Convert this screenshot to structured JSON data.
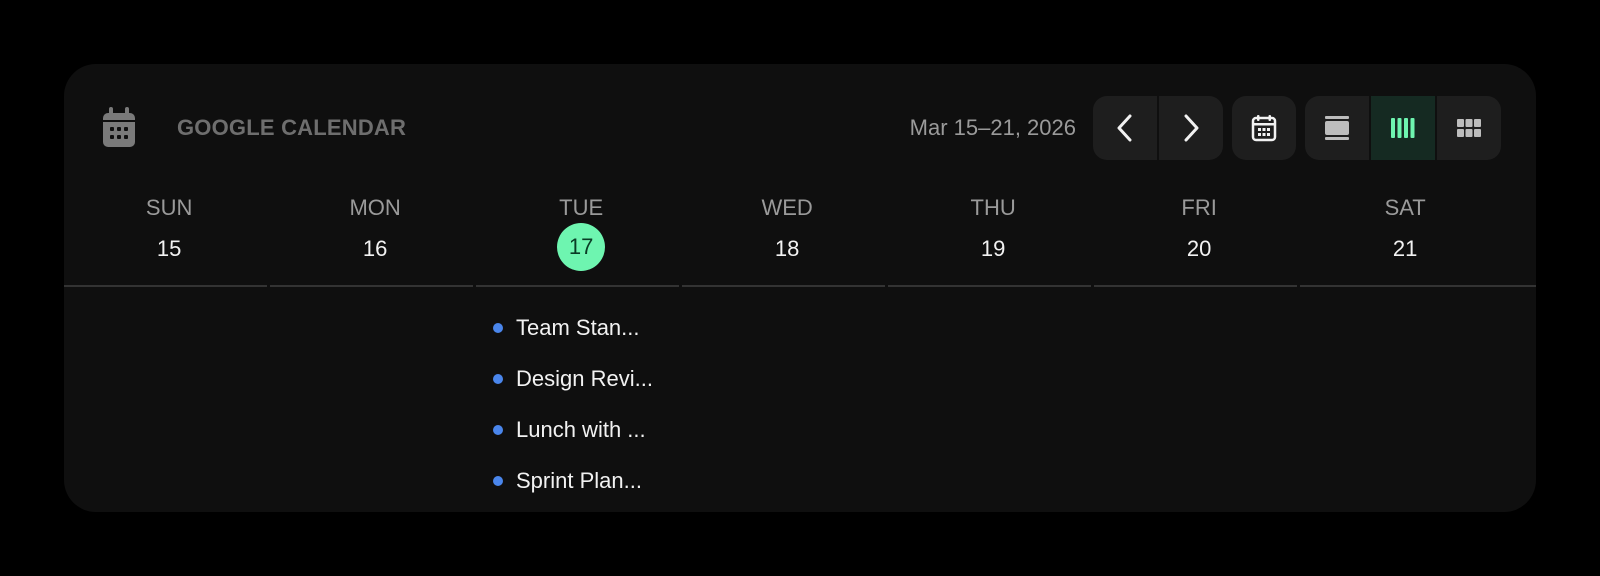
{
  "app": {
    "title": "GOOGLE CALENDAR",
    "icon": "calendar-icon"
  },
  "toolbar": {
    "date_range": "Mar 15–21, 2026",
    "prev_icon": "chevron-left-icon",
    "next_icon": "chevron-right-icon",
    "today_icon": "calendar-icon",
    "views": [
      {
        "name": "day-view",
        "icon": "day-view-icon",
        "active": false
      },
      {
        "name": "week-view",
        "icon": "week-view-icon",
        "active": true
      },
      {
        "name": "month-view",
        "icon": "month-view-icon",
        "active": false
      }
    ],
    "accent_color": "#6ef5b0"
  },
  "week": {
    "days": [
      {
        "name": "SUN",
        "num": "15",
        "today": false
      },
      {
        "name": "MON",
        "num": "16",
        "today": false
      },
      {
        "name": "TUE",
        "num": "17",
        "today": true
      },
      {
        "name": "WED",
        "num": "18",
        "today": false
      },
      {
        "name": "THU",
        "num": "19",
        "today": false
      },
      {
        "name": "FRI",
        "num": "20",
        "today": false
      },
      {
        "name": "SAT",
        "num": "21",
        "today": false
      }
    ]
  },
  "events": [
    {
      "title": "Team Stan...",
      "color": "#4a86ec"
    },
    {
      "title": "Design Revi...",
      "color": "#4a86ec"
    },
    {
      "title": "Lunch with ...",
      "color": "#4a86ec"
    },
    {
      "title": "Sprint Plan...",
      "color": "#4a86ec"
    }
  ]
}
